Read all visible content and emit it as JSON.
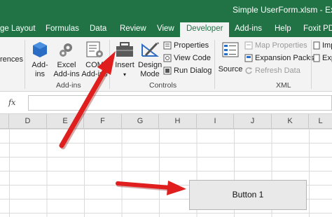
{
  "title_bar": {
    "document_title": "Simple UserForm.xlsm  -  Excel"
  },
  "ribbon_tabs": [
    {
      "label": "ge Layout"
    },
    {
      "label": "Formulas"
    },
    {
      "label": "Data"
    },
    {
      "label": "Review"
    },
    {
      "label": "View"
    },
    {
      "label": "Developer",
      "active": true
    },
    {
      "label": "Add-ins"
    },
    {
      "label": "Help"
    },
    {
      "label": "Foxit PDF"
    }
  ],
  "ribbon": {
    "clipped_left_label": "rences",
    "addins_group": {
      "label": "Add-ins",
      "buttons": [
        {
          "line1": "Add-",
          "line2": "ins"
        },
        {
          "line1": "Excel",
          "line2": "Add-ins"
        },
        {
          "line1": "COM",
          "line2": "Add-ins"
        }
      ]
    },
    "controls_group": {
      "label": "Controls",
      "insert": "Insert",
      "design_mode_line1": "Design",
      "design_mode_line2": "Mode",
      "properties": "Properties",
      "view_code": "View Code",
      "run_dialog": "Run Dialog"
    },
    "xml_group": {
      "label": "XML",
      "source": "Source",
      "map_properties": "Map Properties",
      "expansion_packs": "Expansion Packs",
      "refresh_data": "Refresh Data",
      "clipped_right": "Imp",
      "clipped_right2": "Exp"
    }
  },
  "formula_bar": {
    "fx_label": "fx",
    "value": ""
  },
  "column_headers": [
    "D",
    "E",
    "F",
    "G",
    "H",
    "I",
    "J",
    "K",
    "L"
  ],
  "form_button": {
    "label": "Button 1"
  },
  "colors": {
    "excel_green": "#217346",
    "annotation_red": "#e01e1e"
  }
}
